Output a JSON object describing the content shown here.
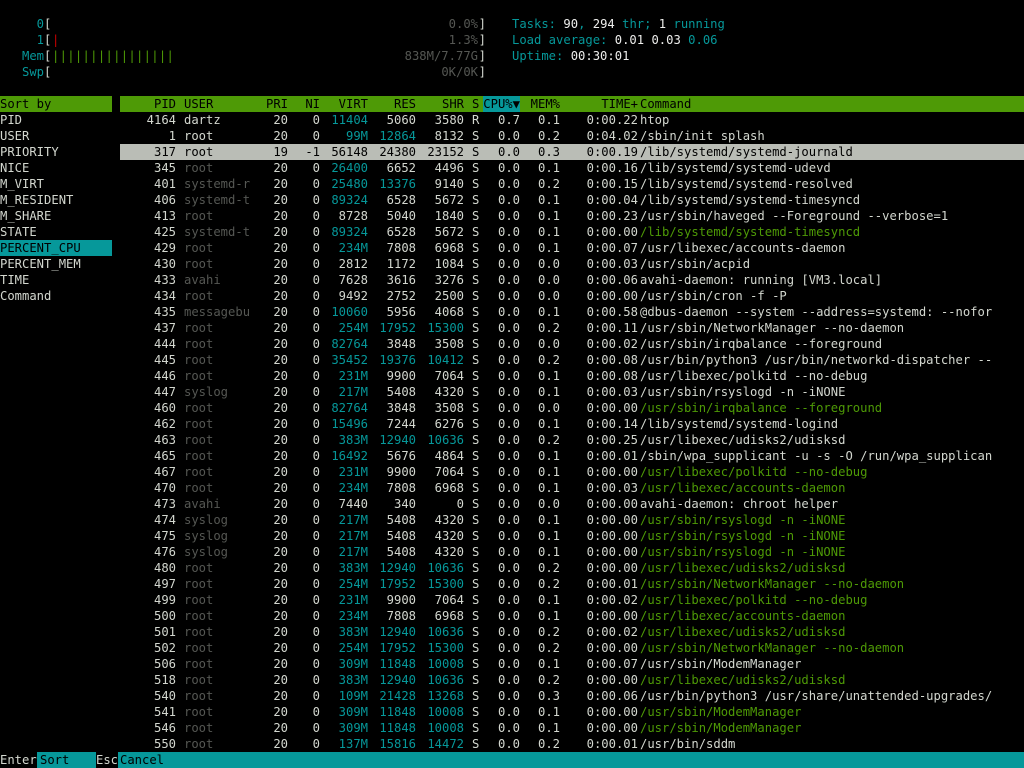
{
  "meters": [
    {
      "label": "0",
      "bars": "",
      "value": "0.0%"
    },
    {
      "label": "1",
      "bars": "",
      "value": "1.3%"
    },
    {
      "label": "Mem",
      "bars": "||||||||||||||||",
      "value": "838M/7.77G"
    },
    {
      "label": "Swp",
      "bars": "",
      "value": "0K/0K"
    }
  ],
  "info": {
    "tasks_label": "Tasks: ",
    "tasks": "90",
    "sep1": ", ",
    "threads": "294",
    "thr_label": " thr; ",
    "running": "1",
    "running_label": " running",
    "load_label": "Load average: ",
    "load1": "0.01",
    "load5": "0.03",
    "load15": "0.06",
    "uptime_label": "Uptime: ",
    "uptime": "00:30:01"
  },
  "sort_panel": {
    "title": "Sort by",
    "items": [
      "PID",
      "USER",
      "PRIORITY",
      "NICE",
      "M_VIRT",
      "M_RESIDENT",
      "M_SHARE",
      "STATE",
      "PERCENT_CPU",
      "PERCENT_MEM",
      "TIME",
      "Command"
    ],
    "selected": "PERCENT_CPU"
  },
  "columns": {
    "pid": "PID",
    "user": "USER",
    "pri": "PRI",
    "ni": "NI",
    "virt": "VIRT",
    "res": "RES",
    "shr": "SHR",
    "s": "S",
    "cpu": "CPU%",
    "mem": "MEM%",
    "time": "TIME+",
    "command": "Command"
  },
  "processes": [
    {
      "pid": "4164",
      "user": "dartz",
      "pri": "20",
      "ni": "0",
      "virt": "11404",
      "res": "5060",
      "shr": "3580",
      "s": "R",
      "cpu": "0.7",
      "mem": "0.1",
      "time": "0:00.22",
      "command": "htop"
    },
    {
      "pid": "1",
      "user": "root",
      "pri": "20",
      "ni": "0",
      "virt": "99M",
      "res": "12864",
      "shr": "8132",
      "s": "S",
      "cpu": "0.0",
      "mem": "0.2",
      "time": "0:04.02",
      "command": "/sbin/init splash"
    },
    {
      "pid": "317",
      "user": "root",
      "pri": "19",
      "ni": "-1",
      "virt": "56148",
      "res": "24380",
      "shr": "23152",
      "s": "S",
      "cpu": "0.0",
      "mem": "0.3",
      "time": "0:00.19",
      "command": "/lib/systemd/systemd-journald",
      "selected": true
    },
    {
      "pid": "345",
      "user": "root",
      "pri": "20",
      "ni": "0",
      "virt": "26400",
      "res": "6652",
      "shr": "4496",
      "s": "S",
      "cpu": "0.0",
      "mem": "0.1",
      "time": "0:00.16",
      "command": "/lib/systemd/systemd-udevd"
    },
    {
      "pid": "401",
      "user": "systemd-r",
      "pri": "20",
      "ni": "0",
      "virt": "25480",
      "res": "13376",
      "shr": "9140",
      "s": "S",
      "cpu": "0.0",
      "mem": "0.2",
      "time": "0:00.15",
      "command": "/lib/systemd/systemd-resolved"
    },
    {
      "pid": "406",
      "user": "systemd-t",
      "pri": "20",
      "ni": "0",
      "virt": "89324",
      "res": "6528",
      "shr": "5672",
      "s": "S",
      "cpu": "0.0",
      "mem": "0.1",
      "time": "0:00.04",
      "command": "/lib/systemd/systemd-timesyncd"
    },
    {
      "pid": "413",
      "user": "root",
      "pri": "20",
      "ni": "0",
      "virt": "8728",
      "res": "5040",
      "shr": "1840",
      "s": "S",
      "cpu": "0.0",
      "mem": "0.1",
      "time": "0:00.23",
      "command": "/usr/sbin/haveged --Foreground --verbose=1"
    },
    {
      "pid": "425",
      "user": "systemd-t",
      "pri": "20",
      "ni": "0",
      "virt": "89324",
      "res": "6528",
      "shr": "5672",
      "s": "S",
      "cpu": "0.0",
      "mem": "0.1",
      "time": "0:00.00",
      "command": "/lib/systemd/systemd-timesyncd",
      "thread": true
    },
    {
      "pid": "429",
      "user": "root",
      "pri": "20",
      "ni": "0",
      "virt": "234M",
      "res": "7808",
      "shr": "6968",
      "s": "S",
      "cpu": "0.0",
      "mem": "0.1",
      "time": "0:00.07",
      "command": "/usr/libexec/accounts-daemon"
    },
    {
      "pid": "430",
      "user": "root",
      "pri": "20",
      "ni": "0",
      "virt": "2812",
      "res": "1172",
      "shr": "1084",
      "s": "S",
      "cpu": "0.0",
      "mem": "0.0",
      "time": "0:00.03",
      "command": "/usr/sbin/acpid"
    },
    {
      "pid": "433",
      "user": "avahi",
      "pri": "20",
      "ni": "0",
      "virt": "7628",
      "res": "3616",
      "shr": "3276",
      "s": "S",
      "cpu": "0.0",
      "mem": "0.0",
      "time": "0:00.06",
      "command": "avahi-daemon: running [VM3.local]"
    },
    {
      "pid": "434",
      "user": "root",
      "pri": "20",
      "ni": "0",
      "virt": "9492",
      "res": "2752",
      "shr": "2500",
      "s": "S",
      "cpu": "0.0",
      "mem": "0.0",
      "time": "0:00.00",
      "command": "/usr/sbin/cron -f -P"
    },
    {
      "pid": "435",
      "user": "messagebu",
      "pri": "20",
      "ni": "0",
      "virt": "10060",
      "res": "5956",
      "shr": "4068",
      "s": "S",
      "cpu": "0.0",
      "mem": "0.1",
      "time": "0:00.58",
      "command": "@dbus-daemon --system --address=systemd: --nofor"
    },
    {
      "pid": "437",
      "user": "root",
      "pri": "20",
      "ni": "0",
      "virt": "254M",
      "res": "17952",
      "shr": "15300",
      "s": "S",
      "cpu": "0.0",
      "mem": "0.2",
      "time": "0:00.11",
      "command": "/usr/sbin/NetworkManager --no-daemon"
    },
    {
      "pid": "444",
      "user": "root",
      "pri": "20",
      "ni": "0",
      "virt": "82764",
      "res": "3848",
      "shr": "3508",
      "s": "S",
      "cpu": "0.0",
      "mem": "0.0",
      "time": "0:00.02",
      "command": "/usr/sbin/irqbalance --foreground"
    },
    {
      "pid": "445",
      "user": "root",
      "pri": "20",
      "ni": "0",
      "virt": "35452",
      "res": "19376",
      "shr": "10412",
      "s": "S",
      "cpu": "0.0",
      "mem": "0.2",
      "time": "0:00.08",
      "command": "/usr/bin/python3 /usr/bin/networkd-dispatcher --"
    },
    {
      "pid": "446",
      "user": "root",
      "pri": "20",
      "ni": "0",
      "virt": "231M",
      "res": "9900",
      "shr": "7064",
      "s": "S",
      "cpu": "0.0",
      "mem": "0.1",
      "time": "0:00.08",
      "command": "/usr/libexec/polkitd --no-debug"
    },
    {
      "pid": "447",
      "user": "syslog",
      "pri": "20",
      "ni": "0",
      "virt": "217M",
      "res": "5408",
      "shr": "4320",
      "s": "S",
      "cpu": "0.0",
      "mem": "0.1",
      "time": "0:00.03",
      "command": "/usr/sbin/rsyslogd -n -iNONE"
    },
    {
      "pid": "460",
      "user": "root",
      "pri": "20",
      "ni": "0",
      "virt": "82764",
      "res": "3848",
      "shr": "3508",
      "s": "S",
      "cpu": "0.0",
      "mem": "0.0",
      "time": "0:00.00",
      "command": "/usr/sbin/irqbalance --foreground",
      "thread": true
    },
    {
      "pid": "462",
      "user": "root",
      "pri": "20",
      "ni": "0",
      "virt": "15496",
      "res": "7244",
      "shr": "6276",
      "s": "S",
      "cpu": "0.0",
      "mem": "0.1",
      "time": "0:00.14",
      "command": "/lib/systemd/systemd-logind"
    },
    {
      "pid": "463",
      "user": "root",
      "pri": "20",
      "ni": "0",
      "virt": "383M",
      "res": "12940",
      "shr": "10636",
      "s": "S",
      "cpu": "0.0",
      "mem": "0.2",
      "time": "0:00.25",
      "command": "/usr/libexec/udisks2/udisksd"
    },
    {
      "pid": "465",
      "user": "root",
      "pri": "20",
      "ni": "0",
      "virt": "16492",
      "res": "5676",
      "shr": "4864",
      "s": "S",
      "cpu": "0.0",
      "mem": "0.1",
      "time": "0:00.01",
      "command": "/sbin/wpa_supplicant -u -s -O /run/wpa_supplican"
    },
    {
      "pid": "467",
      "user": "root",
      "pri": "20",
      "ni": "0",
      "virt": "231M",
      "res": "9900",
      "shr": "7064",
      "s": "S",
      "cpu": "0.0",
      "mem": "0.1",
      "time": "0:00.00",
      "command": "/usr/libexec/polkitd --no-debug",
      "thread": true
    },
    {
      "pid": "470",
      "user": "root",
      "pri": "20",
      "ni": "0",
      "virt": "234M",
      "res": "7808",
      "shr": "6968",
      "s": "S",
      "cpu": "0.0",
      "mem": "0.1",
      "time": "0:00.03",
      "command": "/usr/libexec/accounts-daemon",
      "thread": true
    },
    {
      "pid": "473",
      "user": "avahi",
      "pri": "20",
      "ni": "0",
      "virt": "7440",
      "res": "340",
      "shr": "0",
      "s": "S",
      "cpu": "0.0",
      "mem": "0.0",
      "time": "0:00.00",
      "command": "avahi-daemon: chroot helper"
    },
    {
      "pid": "474",
      "user": "syslog",
      "pri": "20",
      "ni": "0",
      "virt": "217M",
      "res": "5408",
      "shr": "4320",
      "s": "S",
      "cpu": "0.0",
      "mem": "0.1",
      "time": "0:00.00",
      "command": "/usr/sbin/rsyslogd -n -iNONE",
      "thread": true
    },
    {
      "pid": "475",
      "user": "syslog",
      "pri": "20",
      "ni": "0",
      "virt": "217M",
      "res": "5408",
      "shr": "4320",
      "s": "S",
      "cpu": "0.0",
      "mem": "0.1",
      "time": "0:00.00",
      "command": "/usr/sbin/rsyslogd -n -iNONE",
      "thread": true
    },
    {
      "pid": "476",
      "user": "syslog",
      "pri": "20",
      "ni": "0",
      "virt": "217M",
      "res": "5408",
      "shr": "4320",
      "s": "S",
      "cpu": "0.0",
      "mem": "0.1",
      "time": "0:00.00",
      "command": "/usr/sbin/rsyslogd -n -iNONE",
      "thread": true
    },
    {
      "pid": "480",
      "user": "root",
      "pri": "20",
      "ni": "0",
      "virt": "383M",
      "res": "12940",
      "shr": "10636",
      "s": "S",
      "cpu": "0.0",
      "mem": "0.2",
      "time": "0:00.00",
      "command": "/usr/libexec/udisks2/udisksd",
      "thread": true
    },
    {
      "pid": "497",
      "user": "root",
      "pri": "20",
      "ni": "0",
      "virt": "254M",
      "res": "17952",
      "shr": "15300",
      "s": "S",
      "cpu": "0.0",
      "mem": "0.2",
      "time": "0:00.01",
      "command": "/usr/sbin/NetworkManager --no-daemon",
      "thread": true
    },
    {
      "pid": "499",
      "user": "root",
      "pri": "20",
      "ni": "0",
      "virt": "231M",
      "res": "9900",
      "shr": "7064",
      "s": "S",
      "cpu": "0.0",
      "mem": "0.1",
      "time": "0:00.02",
      "command": "/usr/libexec/polkitd --no-debug",
      "thread": true
    },
    {
      "pid": "500",
      "user": "root",
      "pri": "20",
      "ni": "0",
      "virt": "234M",
      "res": "7808",
      "shr": "6968",
      "s": "S",
      "cpu": "0.0",
      "mem": "0.1",
      "time": "0:00.00",
      "command": "/usr/libexec/accounts-daemon",
      "thread": true
    },
    {
      "pid": "501",
      "user": "root",
      "pri": "20",
      "ni": "0",
      "virt": "383M",
      "res": "12940",
      "shr": "10636",
      "s": "S",
      "cpu": "0.0",
      "mem": "0.2",
      "time": "0:00.02",
      "command": "/usr/libexec/udisks2/udisksd",
      "thread": true
    },
    {
      "pid": "502",
      "user": "root",
      "pri": "20",
      "ni": "0",
      "virt": "254M",
      "res": "17952",
      "shr": "15300",
      "s": "S",
      "cpu": "0.0",
      "mem": "0.2",
      "time": "0:00.00",
      "command": "/usr/sbin/NetworkManager --no-daemon",
      "thread": true
    },
    {
      "pid": "506",
      "user": "root",
      "pri": "20",
      "ni": "0",
      "virt": "309M",
      "res": "11848",
      "shr": "10008",
      "s": "S",
      "cpu": "0.0",
      "mem": "0.1",
      "time": "0:00.07",
      "command": "/usr/sbin/ModemManager"
    },
    {
      "pid": "518",
      "user": "root",
      "pri": "20",
      "ni": "0",
      "virt": "383M",
      "res": "12940",
      "shr": "10636",
      "s": "S",
      "cpu": "0.0",
      "mem": "0.2",
      "time": "0:00.00",
      "command": "/usr/libexec/udisks2/udisksd",
      "thread": true
    },
    {
      "pid": "540",
      "user": "root",
      "pri": "20",
      "ni": "0",
      "virt": "109M",
      "res": "21428",
      "shr": "13268",
      "s": "S",
      "cpu": "0.0",
      "mem": "0.3",
      "time": "0:00.06",
      "command": "/usr/bin/python3 /usr/share/unattended-upgrades/"
    },
    {
      "pid": "541",
      "user": "root",
      "pri": "20",
      "ni": "0",
      "virt": "309M",
      "res": "11848",
      "shr": "10008",
      "s": "S",
      "cpu": "0.0",
      "mem": "0.1",
      "time": "0:00.00",
      "command": "/usr/sbin/ModemManager",
      "thread": true
    },
    {
      "pid": "546",
      "user": "root",
      "pri": "20",
      "ni": "0",
      "virt": "309M",
      "res": "11848",
      "shr": "10008",
      "s": "S",
      "cpu": "0.0",
      "mem": "0.1",
      "time": "0:00.00",
      "command": "/usr/sbin/ModemManager",
      "thread": true
    },
    {
      "pid": "550",
      "user": "root",
      "pri": "20",
      "ni": "0",
      "virt": "137M",
      "res": "15816",
      "shr": "14472",
      "s": "S",
      "cpu": "0.0",
      "mem": "0.2",
      "time": "0:00.01",
      "command": "/usr/bin/sddm"
    }
  ],
  "footer": {
    "key1": "Enter",
    "label1": "Sort",
    "key2": "Esc",
    "label2": "Cancel"
  }
}
